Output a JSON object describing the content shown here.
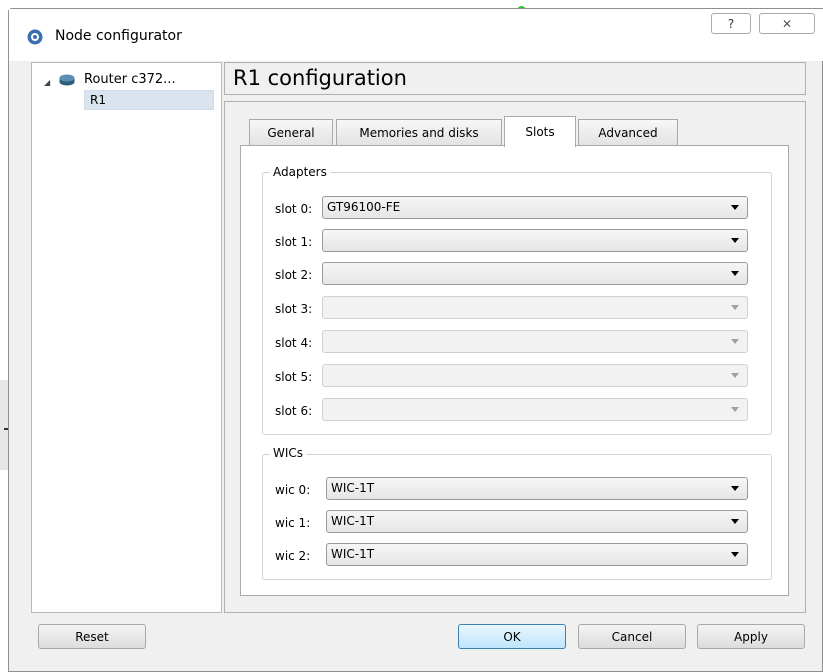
{
  "window": {
    "title": "Node configurator",
    "help_glyph": "?",
    "close_glyph": "✕"
  },
  "tree": {
    "parent_label": "Router c372...",
    "child_label": "R1"
  },
  "header": {
    "title": "R1 configuration"
  },
  "tabs": [
    {
      "label": "General",
      "active": false
    },
    {
      "label": "Memories and disks",
      "active": false
    },
    {
      "label": "Slots",
      "active": true
    },
    {
      "label": "Advanced",
      "active": false
    }
  ],
  "adapters": {
    "group_title": "Adapters",
    "slots": [
      {
        "label": "slot 0:",
        "value": "GT96100-FE",
        "enabled": true
      },
      {
        "label": "slot 1:",
        "value": "",
        "enabled": true
      },
      {
        "label": "slot 2:",
        "value": "",
        "enabled": true
      },
      {
        "label": "slot 3:",
        "value": "",
        "enabled": false
      },
      {
        "label": "slot 4:",
        "value": "",
        "enabled": false
      },
      {
        "label": "slot 5:",
        "value": "",
        "enabled": false
      },
      {
        "label": "slot 6:",
        "value": "",
        "enabled": false
      }
    ]
  },
  "wics": {
    "group_title": "WICs",
    "slots": [
      {
        "label": "wic 0:",
        "value": "WIC-1T",
        "enabled": true
      },
      {
        "label": "wic 1:",
        "value": "WIC-1T",
        "enabled": true
      },
      {
        "label": "wic 2:",
        "value": "WIC-1T",
        "enabled": true
      }
    ]
  },
  "buttons": {
    "reset": "Reset",
    "ok": "OK",
    "cancel": "Cancel",
    "apply": "Apply"
  }
}
